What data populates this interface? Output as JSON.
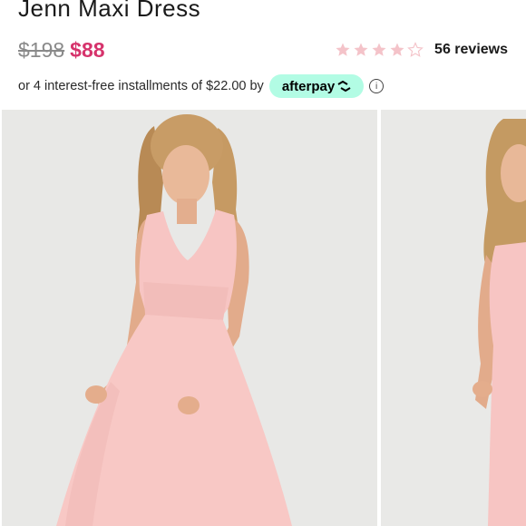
{
  "product": {
    "title": "Jenn Maxi Dress",
    "original_price": "$198",
    "sale_price": "$88",
    "rating": 4,
    "rating_max": 5,
    "reviews_label": "56 reviews"
  },
  "afterpay": {
    "text": "or 4 interest-free installments of $22.00 by",
    "brand": "afterpay",
    "info_glyph": "ⓘ"
  },
  "colors": {
    "sale_price": "#d6336c",
    "star_filled": "#f4c3c9",
    "star_empty": "#f4c3c9",
    "afterpay_badge": "#b2fce4",
    "dress": "#f7c5c3"
  },
  "gallery": {
    "images": [
      {
        "alt": "",
        "icon": "product-photo"
      },
      {
        "alt": "",
        "icon": "product-photo"
      }
    ]
  }
}
